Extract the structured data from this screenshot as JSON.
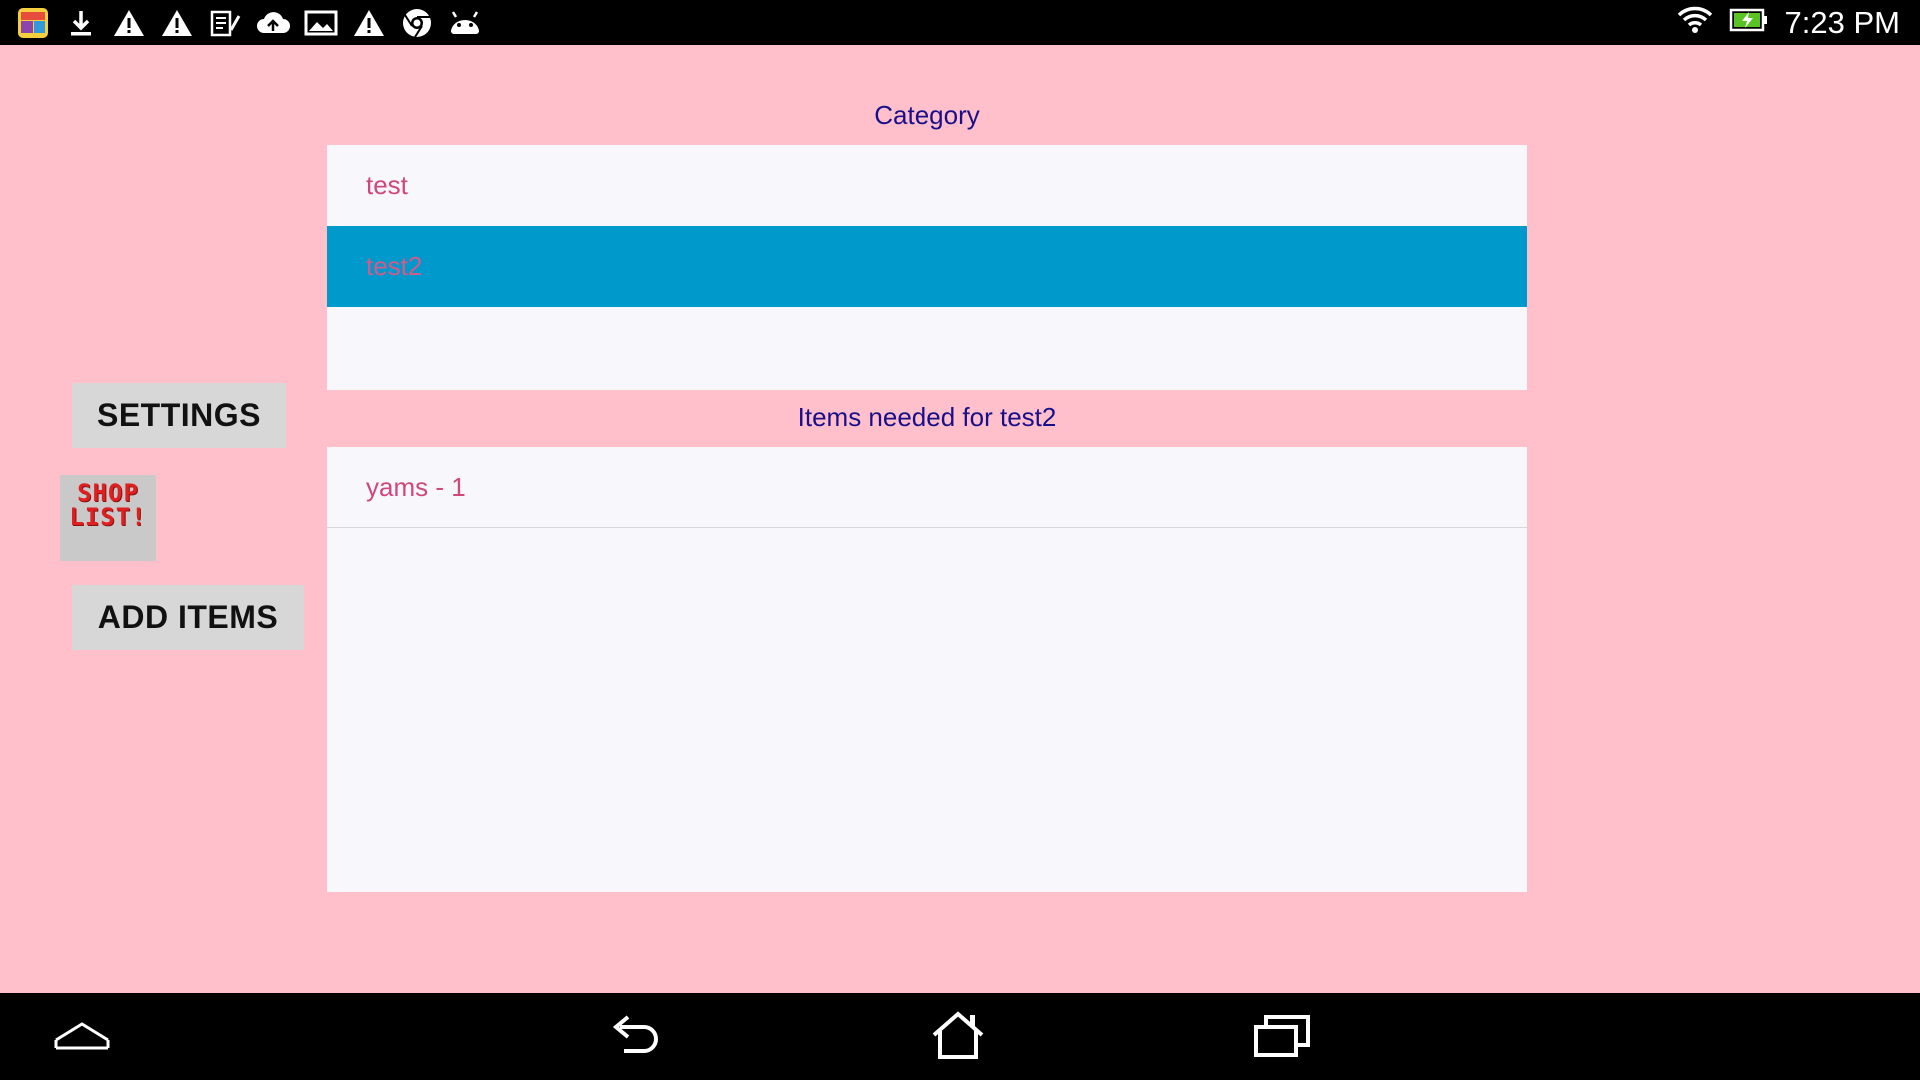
{
  "status_bar": {
    "time": "7:23 PM",
    "left_icons": [
      "app-icon",
      "download-icon",
      "warning-icon",
      "warning-icon",
      "notes-icon",
      "cloud-upload-icon",
      "gallery-icon",
      "warning-icon",
      "chrome-icon",
      "android-icon"
    ],
    "right_icons": [
      "wifi-icon",
      "battery-charging-icon"
    ]
  },
  "sidebar": {
    "settings_label": "SETTINGS",
    "logo_text_line1": "SHOP",
    "logo_text_line2": "LIST!",
    "add_items_label": "ADD ITEMS"
  },
  "category": {
    "heading": "Category",
    "items": [
      {
        "label": "test",
        "selected": false
      },
      {
        "label": "test2",
        "selected": true
      }
    ]
  },
  "items": {
    "heading": "Items needed for test2",
    "rows": [
      {
        "label": "yams - 1"
      }
    ]
  },
  "colors": {
    "background": "#ffc0cb",
    "selected_row": "#0099cc",
    "heading_text": "#1a0f8a",
    "row_text": "#d0477e"
  }
}
